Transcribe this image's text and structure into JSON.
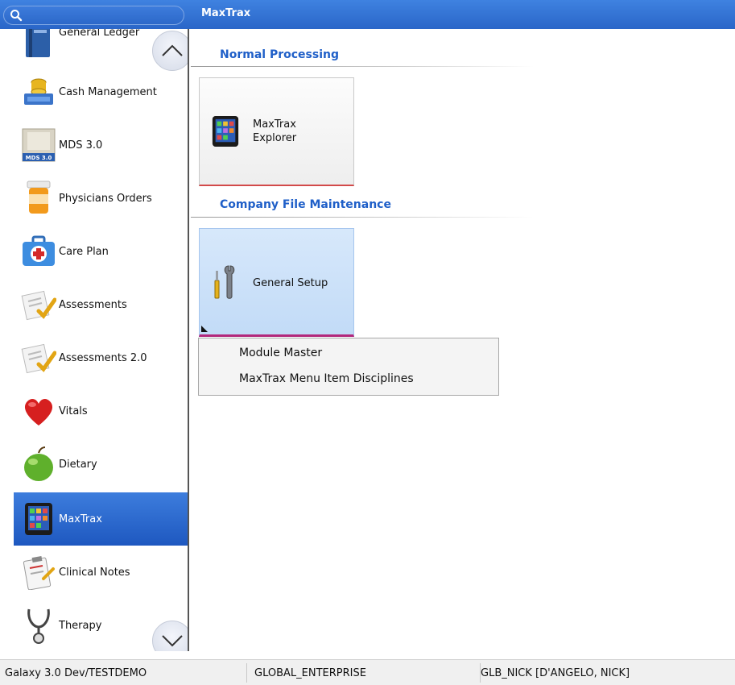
{
  "app": {
    "title": "MaxTrax"
  },
  "search": {
    "icon": "search-icon"
  },
  "sidebar": {
    "items": [
      {
        "label": "General Ledger",
        "icon": "ledger-book-icon"
      },
      {
        "label": "Cash Management",
        "icon": "cash-coins-icon"
      },
      {
        "label": "MDS 3.0",
        "icon": "mds-form-icon"
      },
      {
        "label": "Physicians Orders",
        "icon": "pill-bottle-icon"
      },
      {
        "label": "Care Plan",
        "icon": "first-aid-kit-icon"
      },
      {
        "label": "Assessments",
        "icon": "checklist-icon"
      },
      {
        "label": "Assessments 2.0",
        "icon": "checklist-icon"
      },
      {
        "label": "Vitals",
        "icon": "heart-icon"
      },
      {
        "label": "Dietary",
        "icon": "apple-icon"
      },
      {
        "label": "MaxTrax",
        "icon": "tablet-app-icon",
        "active": true
      },
      {
        "label": "Clinical Notes",
        "icon": "clipboard-icon"
      },
      {
        "label": "Therapy",
        "icon": "stethoscope-icon"
      }
    ]
  },
  "main": {
    "sections": [
      {
        "title": "Normal Processing"
      },
      {
        "title": "Company File Maintenance"
      }
    ],
    "tiles": [
      {
        "line1": "MaxTrax",
        "line2": "Explorer",
        "icon": "tablet-app-icon"
      },
      {
        "line1": "General Setup",
        "icon": "tools-icon"
      }
    ],
    "context_menu": {
      "items": [
        "Module Master",
        "MaxTrax Menu Item Disciplines"
      ]
    }
  },
  "status": {
    "environment": "Galaxy 3.0 Dev/TESTDEMO",
    "enterprise": "GLOBAL_ENTERPRISE",
    "user": "GLB_NICK [D'ANGELO, NICK]"
  },
  "colors": {
    "accent": "#2a66c8",
    "section_title": "#1f5fc8",
    "active_item": "#1e58c0"
  }
}
